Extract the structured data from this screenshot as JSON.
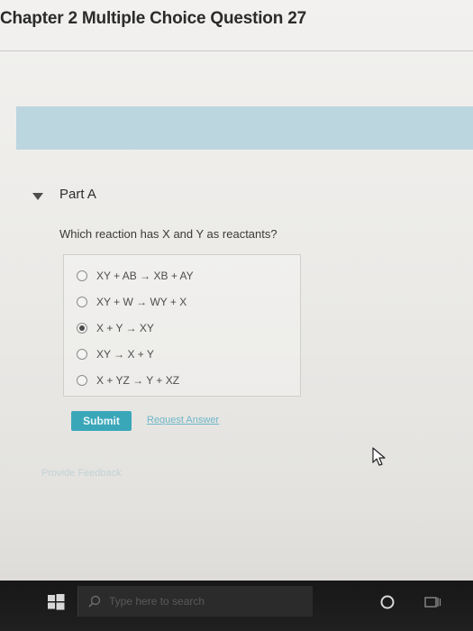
{
  "header": {
    "title": "Chapter 2 Multiple Choice Question 27"
  },
  "part": {
    "label": "Part A"
  },
  "question": {
    "text": "Which reaction has X and Y as reactants?"
  },
  "options": [
    {
      "text": "XY + AB → XB + AY",
      "selected": false
    },
    {
      "text": "XY + W → WY + X",
      "selected": false
    },
    {
      "text": "X + Y → XY",
      "selected": true
    },
    {
      "text": "XY → X + Y",
      "selected": false
    },
    {
      "text": "X + YZ → Y + XZ",
      "selected": false
    }
  ],
  "actions": {
    "submit_label": "Submit",
    "request_answer_label": "Request Answer",
    "feedback_label": "Provide Feedback"
  },
  "taskbar": {
    "search_placeholder": "Type here to search"
  },
  "colors": {
    "accent": "#3aa7b9",
    "banner": "#bcd6e0",
    "link": "#6fb6c8",
    "taskbar": "#1b1b1b"
  },
  "icons": {
    "toggle": "caret-down-icon",
    "start": "windows-logo-icon",
    "search": "search-icon",
    "cortana": "cortana-circle-icon",
    "taskview": "task-view-icon",
    "cursor": "mouse-pointer-icon"
  }
}
